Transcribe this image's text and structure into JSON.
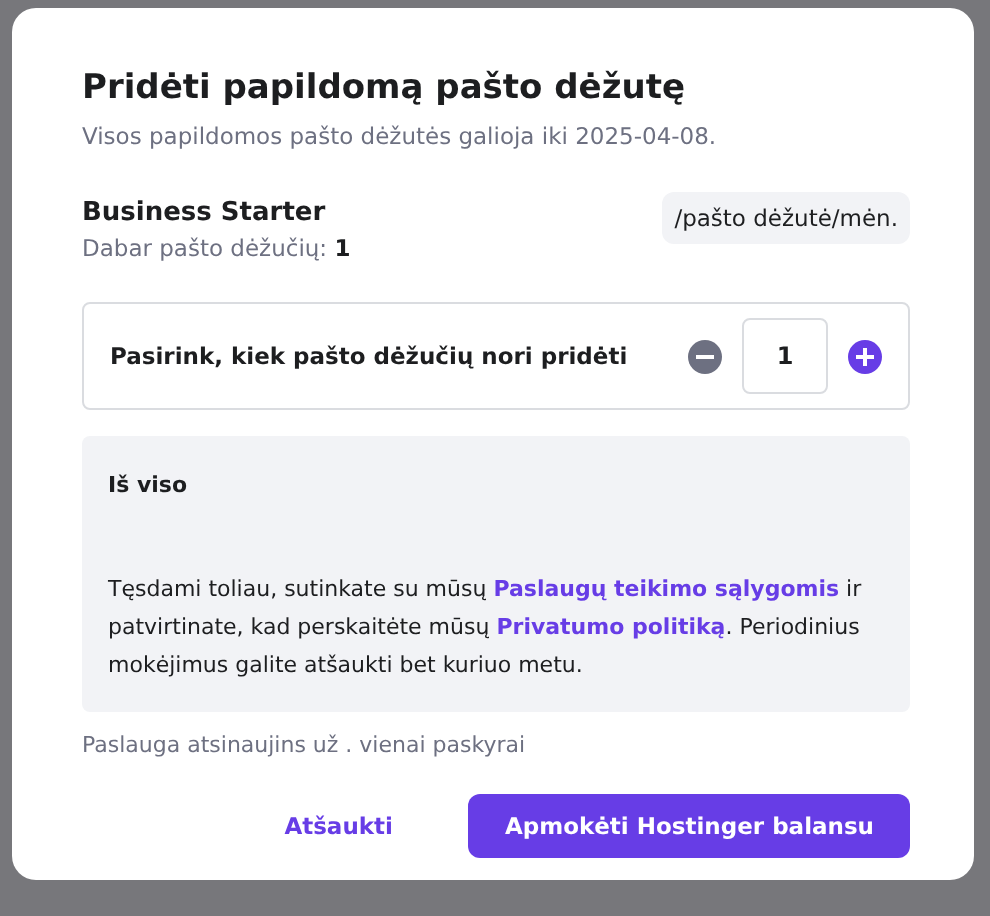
{
  "dialog": {
    "title": "Pridėti papildomą pašto dėžutę",
    "subtitle": "Visos papildomos pašto dėžutės galioja iki 2025-04-08.",
    "plan": {
      "name": "Business Starter",
      "current": "Dabar pašto dėžučių: **1**",
      "price": "/pašto dėžutė/mėn."
    },
    "selector": {
      "label": "Pasirink, kiek pašto dėžučių nori pridėti",
      "value": "1",
      "decrease_disabled": true,
      "increase_disabled": false
    },
    "summary": {
      "title": "Iš viso",
      "terms": [
        {
          "kind": "text",
          "text": "Tęsdami toliau, sutinkate su mūsų "
        },
        {
          "kind": "link",
          "text": "Paslaugų teikimo sąlygomis"
        },
        {
          "kind": "text",
          "text": " ir patvirtinate, kad perskaitėte mūsų "
        },
        {
          "kind": "link",
          "text": "Privatumo politiką"
        },
        {
          "kind": "text",
          "text": ". Periodinius mokėjimus galite atšaukti bet kuriuo metu."
        }
      ]
    },
    "renewal_note": "Paslauga atsinaujins už . vienai paskyrai",
    "buttons": [
      {
        "kind": "secondary",
        "label": "Atšaukti"
      },
      {
        "kind": "primary",
        "label": "Apmokėti Hostinger balansu"
      }
    ]
  }
}
